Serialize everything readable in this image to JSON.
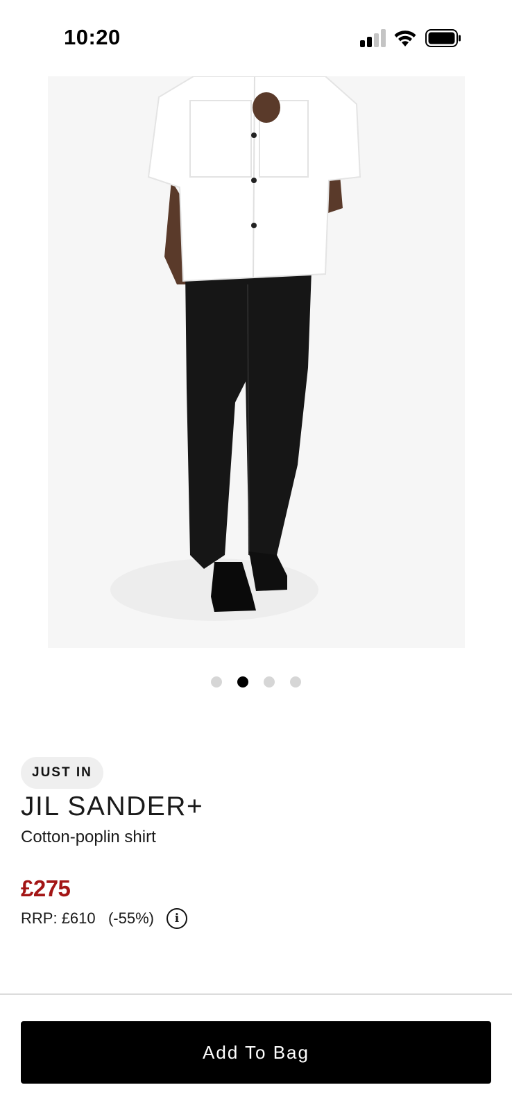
{
  "status_bar": {
    "time": "10:20",
    "icons": [
      "signal-icon",
      "wifi-icon",
      "battery-icon"
    ]
  },
  "gallery": {
    "image": "product-photo-white-shirt-black-trousers",
    "page_count": 4,
    "active_index": 1
  },
  "product": {
    "badge": "JUST IN",
    "brand": "JIL SANDER+",
    "name": "Cotton-poplin shirt",
    "price": "£275",
    "rrp_label": "RRP:",
    "rrp_value": "£610",
    "discount": "(-55%)",
    "info_icon": "i",
    "price_color": "#a31515"
  },
  "actions": {
    "add_to_bag": "Add To Bag"
  }
}
